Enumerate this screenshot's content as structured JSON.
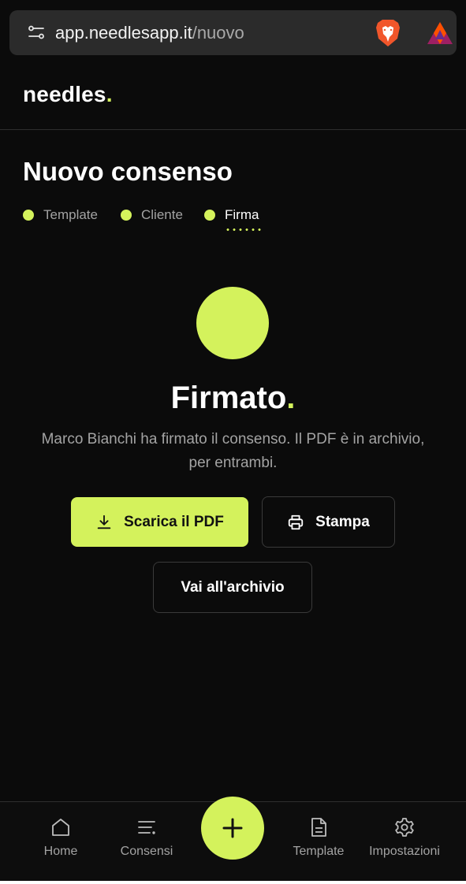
{
  "browser": {
    "url_host": "app.needlesapp.it",
    "url_path": "/nuovo",
    "icons": [
      "tune-icon",
      "brave-lion-icon",
      "bat-rewards-icon"
    ]
  },
  "app": {
    "logo_text": "needles",
    "logo_dot": "."
  },
  "page": {
    "title": "Nuovo consenso",
    "steps": [
      {
        "label": "Template"
      },
      {
        "label": "Cliente"
      },
      {
        "label": "Firma"
      }
    ],
    "active_step": "Firma"
  },
  "result": {
    "title": "Firmato",
    "title_dot": ".",
    "description": "Marco Bianchi ha firmato il consenso. Il PDF è in archivio, per entrambi."
  },
  "actions": {
    "download_label": "Scarica il PDF",
    "print_label": "Stampa",
    "archive_label": "Vai all'archivio"
  },
  "bottom_nav": {
    "items": [
      {
        "label": "Home",
        "icon": "home-icon"
      },
      {
        "label": "Consensi",
        "icon": "list-icon"
      },
      {
        "label": "Template",
        "icon": "document-icon"
      },
      {
        "label": "Impostazioni",
        "icon": "gear-icon"
      }
    ],
    "fab_icon": "plus-icon"
  },
  "colors": {
    "accent": "#d4f25c",
    "background": "#0b0b0b",
    "muted_text": "#a3a3a3"
  }
}
